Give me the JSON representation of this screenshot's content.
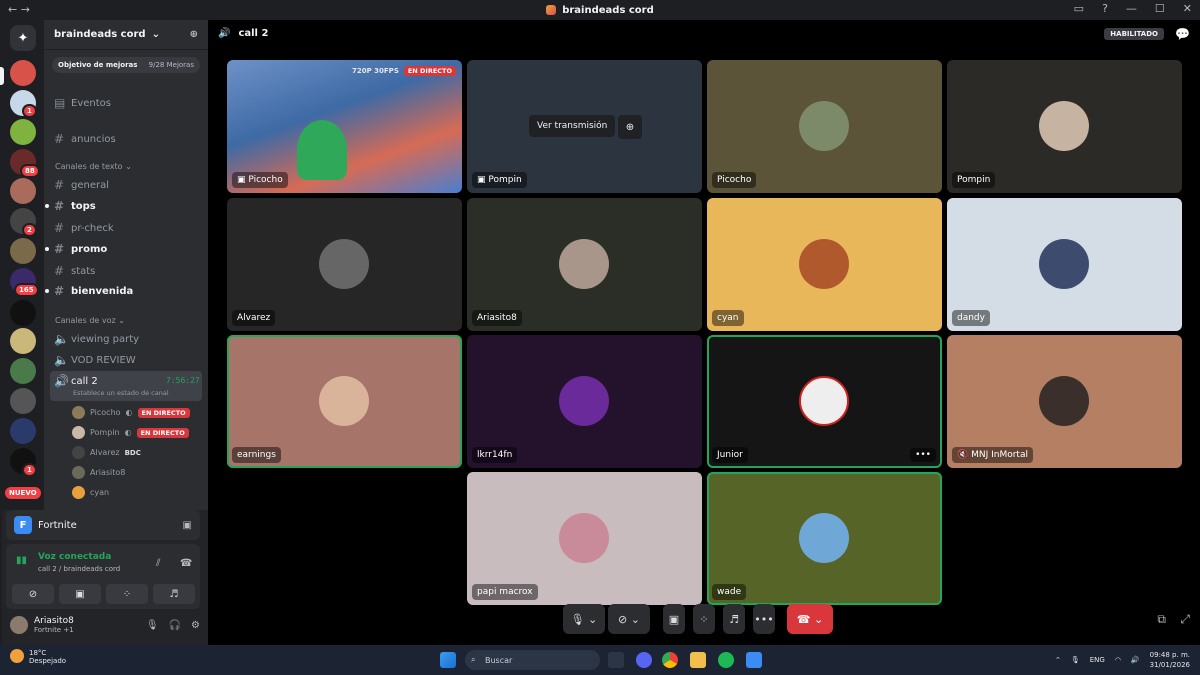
{
  "window": {
    "title": "braindeads cord"
  },
  "rail": {
    "badges": [
      "1",
      "88",
      "2",
      "165",
      "1"
    ],
    "nuevo": "NUEVO"
  },
  "server": {
    "name": "braindeads cord",
    "goal_label": "Objetivo de mejoras",
    "goal_count": "9/28 Mejoras",
    "events": "Eventos",
    "channels_top": [
      "anuncios"
    ],
    "text_category": "Canales de texto",
    "text_channels": [
      {
        "name": "general",
        "unread": false
      },
      {
        "name": "tops",
        "unread": true
      },
      {
        "name": "pr-check",
        "unread": false
      },
      {
        "name": "promo",
        "unread": true
      },
      {
        "name": "stats",
        "unread": false
      },
      {
        "name": "bienvenida",
        "unread": true
      }
    ],
    "voice_category": "Canales de voz",
    "voice_channels": [
      "viewing party",
      "VOD REVIEW"
    ],
    "active_voice": {
      "name": "call 2",
      "timer": "7:56:27",
      "status_hint": "Establece un estado de canal"
    },
    "members": [
      {
        "name": "Picocho",
        "tag": "EN DIRECTO"
      },
      {
        "name": "Pompin",
        "tag": "EN DIRECTO"
      },
      {
        "name": "Alvarez",
        "tag": "BDC"
      },
      {
        "name": "Ariasito8",
        "tag": ""
      },
      {
        "name": "cyan",
        "tag": ""
      }
    ]
  },
  "activity": {
    "game": "Fortnite"
  },
  "voice_panel": {
    "status": "Voz conectada",
    "location": "call 2 / braindeads cord"
  },
  "user": {
    "name": "Ariasito8",
    "status": "Fortnite +1"
  },
  "stage": {
    "channel": "call 2",
    "badge": "HABILITADO",
    "stream_quality": "720P 30FPS",
    "live_label": "EN DIRECTO",
    "watch_label": "Ver transmisión",
    "tiles": [
      {
        "name": "Picocho",
        "kind": "stream",
        "bg": "#5a7fb5"
      },
      {
        "name": "Pompin",
        "kind": "stream-preview",
        "bg": "#2c3440"
      },
      {
        "name": "Picocho",
        "kind": "cam",
        "bg": "#5c5438"
      },
      {
        "name": "Pompin",
        "kind": "cam",
        "bg": "#2c2a27"
      },
      {
        "name": "Alvarez",
        "kind": "cam",
        "bg": "#262626"
      },
      {
        "name": "Ariasito8",
        "kind": "cam",
        "bg": "#2a2e27"
      },
      {
        "name": "cyan",
        "kind": "cam",
        "bg": "#e8b75a"
      },
      {
        "name": "dandy",
        "kind": "cam",
        "bg": "#d4dde6"
      },
      {
        "name": "earnings",
        "kind": "cam",
        "bg": "#a7746a"
      },
      {
        "name": "lkrr14fn",
        "kind": "cam",
        "bg": "#24112c"
      },
      {
        "name": "Junior",
        "kind": "cam",
        "bg": "#151515"
      },
      {
        "name": "MNJ InMortal",
        "kind": "cam",
        "bg": "#b57f63"
      },
      {
        "name": "papi macrox",
        "kind": "cam",
        "bg": "#c9bcbf"
      },
      {
        "name": "wade",
        "kind": "cam",
        "bg": "#566427"
      }
    ]
  },
  "taskbar": {
    "temp": "18°C",
    "weather": "Despejado",
    "search_placeholder": "Buscar",
    "lang": "ENG",
    "time": "09:48 p. m.",
    "date": "31/01/2026"
  }
}
